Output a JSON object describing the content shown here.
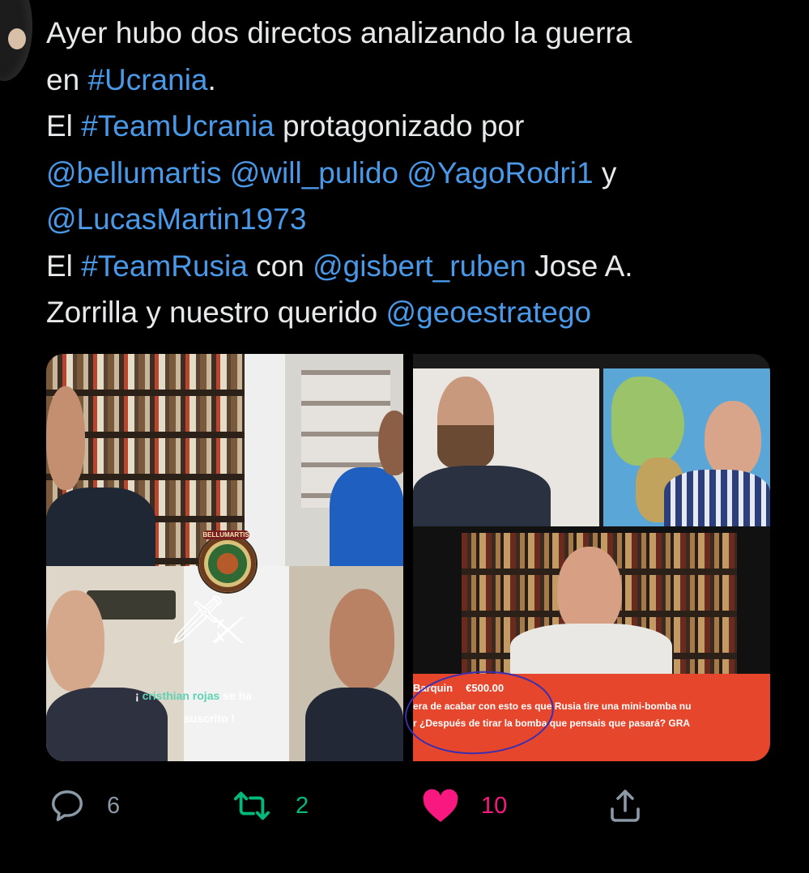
{
  "tweet": {
    "lines": [
      [
        {
          "t": "Ayer hubo dos directos analizando la guerra",
          "link": false
        }
      ],
      [
        {
          "t": "en ",
          "link": false
        },
        {
          "t": "#Ucrania",
          "link": true
        },
        {
          "t": ".",
          "link": false
        }
      ],
      [
        {
          "t": "El ",
          "link": false
        },
        {
          "t": "#TeamUcrania",
          "link": true
        },
        {
          "t": " protagonizado por",
          "link": false
        }
      ],
      [
        {
          "t": "@bellumartis",
          "link": true
        },
        {
          "t": " ",
          "link": false
        },
        {
          "t": "@will_pulido",
          "link": true
        },
        {
          "t": " ",
          "link": false
        },
        {
          "t": "@YagoRodri1",
          "link": true
        },
        {
          "t": " y",
          "link": false
        }
      ],
      [
        {
          "t": "@LucasMartin1973",
          "link": true
        }
      ],
      [
        {
          "t": "El ",
          "link": false
        },
        {
          "t": "#TeamRusia",
          "link": true
        },
        {
          "t": " con ",
          "link": false
        },
        {
          "t": "@gisbert_ruben",
          "link": true
        },
        {
          "t": " Jose A.",
          "link": false
        }
      ],
      [
        {
          "t": "Zorrilla y nuestro querido ",
          "link": false
        },
        {
          "t": "@geoestratego",
          "link": true
        }
      ]
    ]
  },
  "media": {
    "left": {
      "seal_label": "BELLUMARTIS",
      "subscription": {
        "name": "cristhian rojas",
        "suffix": " se ha",
        "line2": "suscrito !",
        "prefix": "¡ "
      }
    },
    "right": {
      "donation": {
        "user": "Barquin",
        "amount": "€500.00",
        "line1": "era de acabar con esto es que Rusia tire una mini-bomba nu",
        "line2": "r ¿Después de tirar la bomba que pensais que pasará? GRA"
      }
    }
  },
  "actions": {
    "reply_count": "6",
    "retweet_count": "2",
    "like_count": "10"
  },
  "colors": {
    "link": "#4a99e9",
    "retweet": "#00ba7c",
    "like": "#f91880",
    "muted": "#8b98a5"
  }
}
